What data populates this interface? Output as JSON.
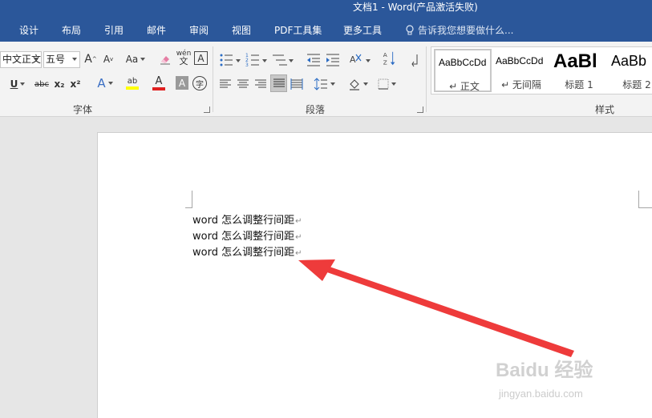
{
  "window": {
    "title": "文档1 - Word(产品激活失败)"
  },
  "tabs": [
    {
      "label": "设计"
    },
    {
      "label": "布局"
    },
    {
      "label": "引用"
    },
    {
      "label": "邮件"
    },
    {
      "label": "审阅"
    },
    {
      "label": "视图"
    },
    {
      "label": "PDF工具集"
    },
    {
      "label": "更多工具"
    }
  ],
  "tell_me": {
    "text": "告诉我您想要做什么..."
  },
  "ribbon": {
    "font": {
      "font_name": "中文正文",
      "font_size": "五号",
      "grow_label": "A",
      "shrink_label": "A",
      "case_label": "Aa",
      "phonetic_label": "wén",
      "border_label": "A",
      "underline_label": "U",
      "strike_label": "abc",
      "sub_label": "x₂",
      "super_label": "x²",
      "effects_label": "A",
      "highlight_label": "ab",
      "color_label": "A",
      "shading_label": "A",
      "enclose_label": "字",
      "group_label": "字体"
    },
    "paragraph": {
      "group_label": "段落"
    },
    "styles": {
      "group_label": "样式",
      "items": [
        {
          "sample": "AaBbCcDd",
          "name": "↵ 正文"
        },
        {
          "sample": "AaBbCcDd",
          "name": "↵ 无间隔"
        },
        {
          "sample": "AaBl",
          "name": "标题 1"
        },
        {
          "sample": "AaBb",
          "name": "标题 2"
        }
      ]
    }
  },
  "document": {
    "lines": [
      "word 怎么调整行间距",
      "word 怎么调整行间距",
      "word 怎么调整行间距"
    ],
    "paragraph_mark": "↵"
  },
  "watermark": {
    "logo": "Baidu 经验",
    "url": "jingyan.baidu.com"
  },
  "colors": {
    "title_bar": "#2b579a",
    "ribbon_bg": "#f3f3f3",
    "annotation_arrow": "#ee3b3b",
    "highlight_yellow": "#ffff00",
    "font_color_red": "#e02020"
  }
}
